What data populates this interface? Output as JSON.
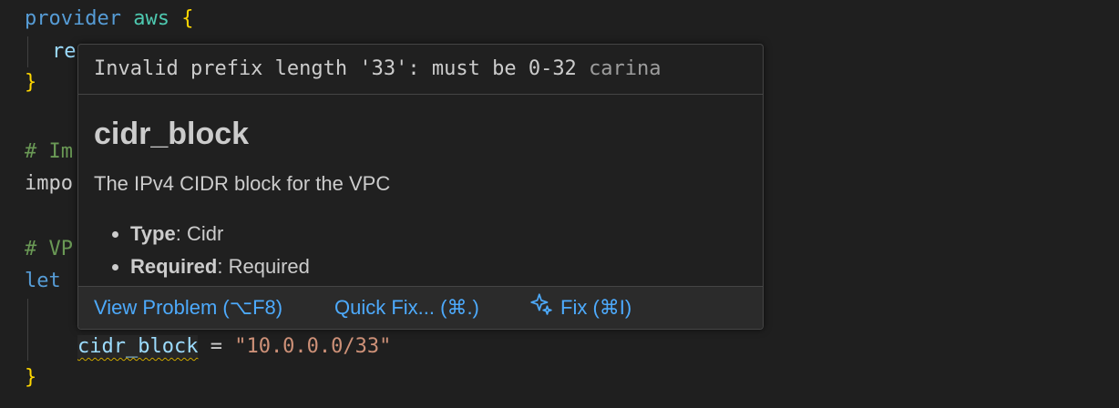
{
  "code": {
    "line1": {
      "kw": "provider",
      "name": "aws",
      "brace": "{"
    },
    "line2": {
      "text": "re"
    },
    "line3": {
      "brace": "}"
    },
    "line5": {
      "comment": "# Im"
    },
    "line6": {
      "text": "impo"
    },
    "line8": {
      "comment": "# VP"
    },
    "line9": {
      "kw": "let"
    },
    "line11": {
      "prop": "cidr_block",
      "op": " = ",
      "value": "\"10.0.0.0/33\""
    },
    "line12": {
      "brace": "}"
    }
  },
  "hover": {
    "diagnostic_message": "Invalid prefix length '33': must be 0-32",
    "diagnostic_source": "carina",
    "title": "cidr_block",
    "description": "The IPv4 CIDR block for the VPC",
    "fields": [
      {
        "label": "Type",
        "value": ": Cidr"
      },
      {
        "label": "Required",
        "value": ": Required"
      }
    ],
    "actions": {
      "view_problem": "View Problem (⌥F8)",
      "quick_fix": "Quick Fix... (⌘.)",
      "fix": "Fix (⌘I)"
    }
  },
  "colors": {
    "background": "#1f1f1f",
    "keyword": "#569cd6",
    "string": "#ce9178",
    "comment": "#6a9955",
    "link": "#4daafc",
    "warning_squiggle": "#cca700"
  },
  "icons": {
    "fix": "sparkle-icon"
  }
}
